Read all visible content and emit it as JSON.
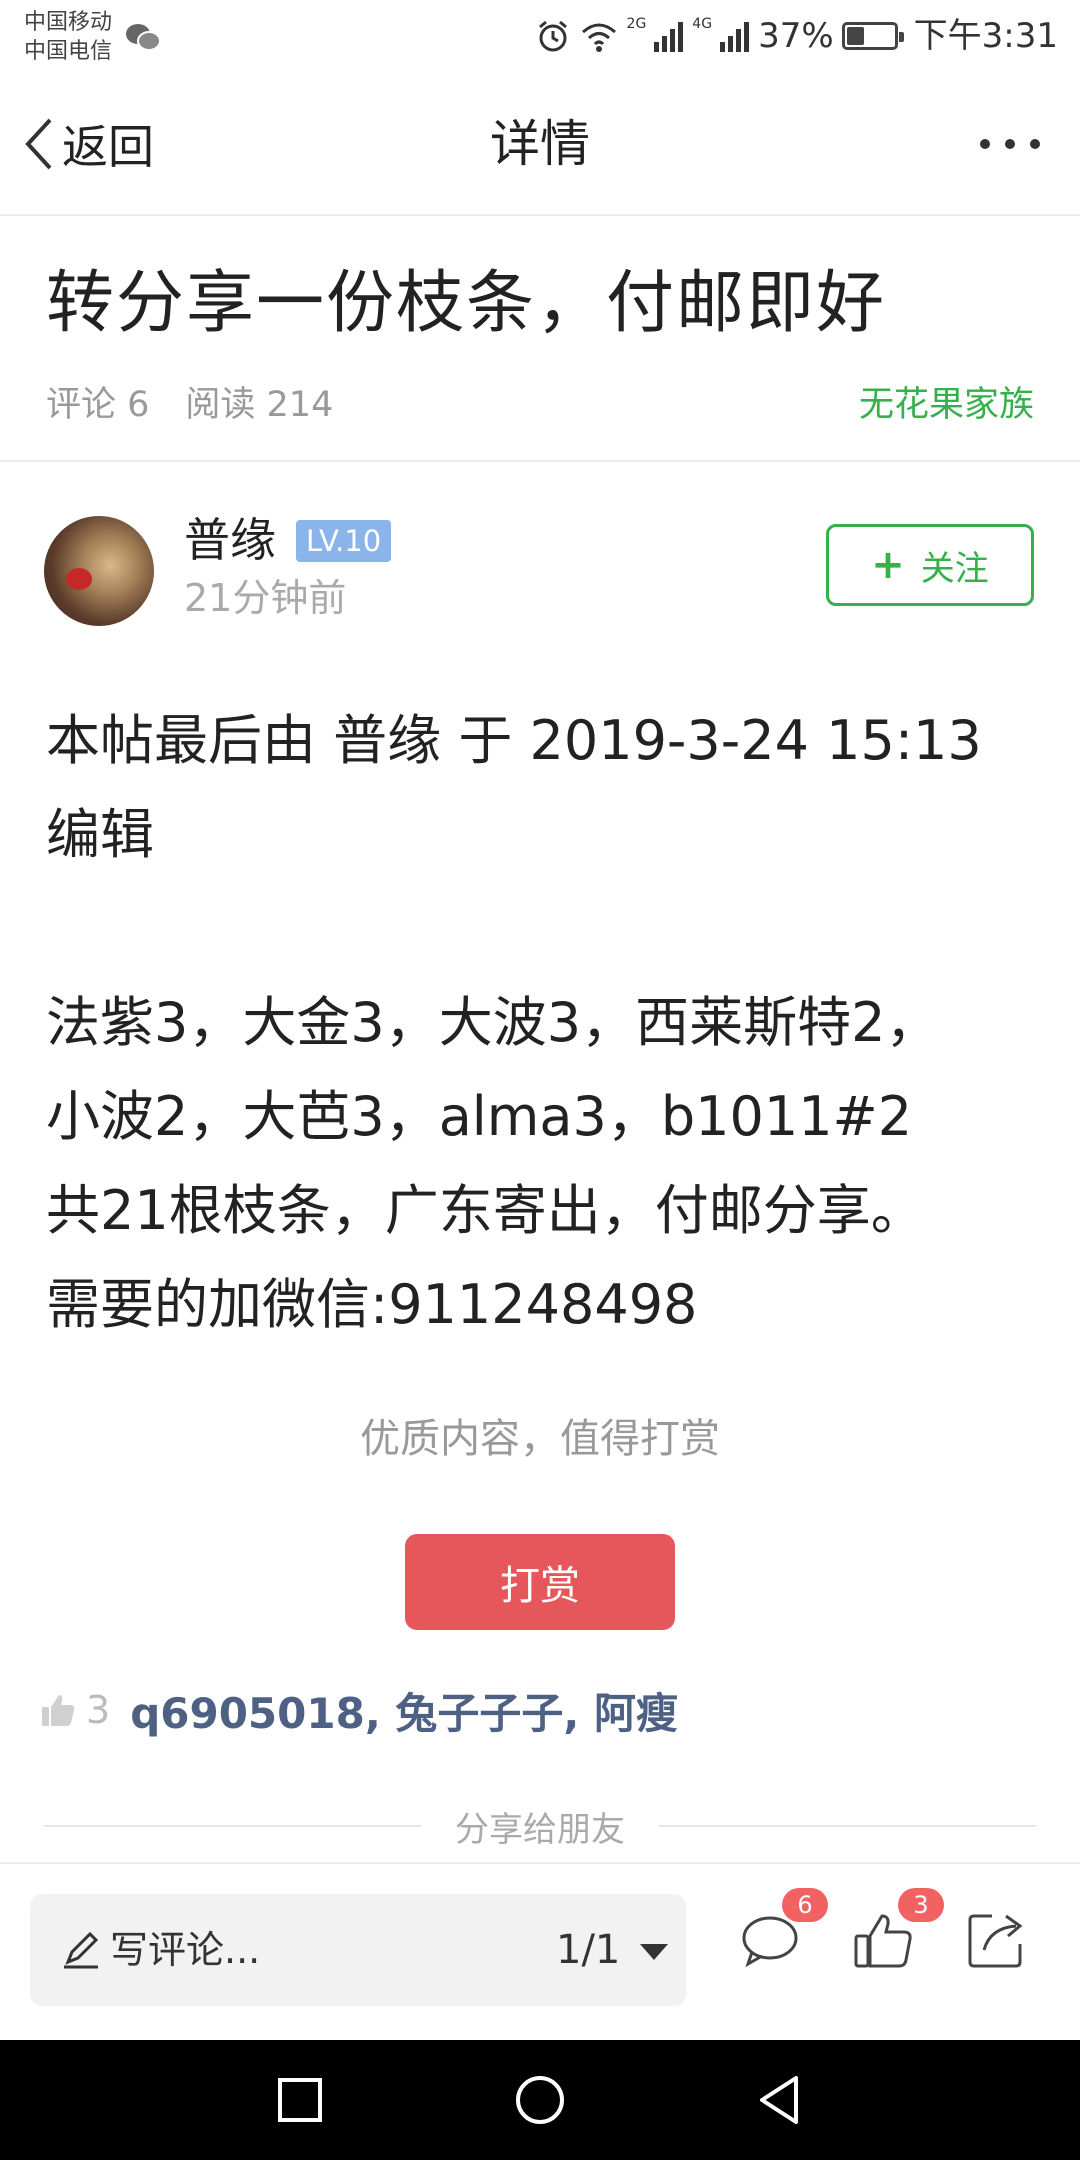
{
  "status_bar": {
    "carrier_1": "中国移动",
    "carrier_2": "中国电信",
    "network_1": "2G",
    "network_2": "4G",
    "battery_text": "37%",
    "battery_level": 0.37,
    "time": "下午3:31"
  },
  "nav": {
    "back_label": "返回",
    "title": "详情",
    "more_icon": "more-dots-icon"
  },
  "post": {
    "title": "转分享一份枝条，付邮即好",
    "comments_label": "评论 6",
    "reads_label": "阅读 214",
    "group": "无花果家族"
  },
  "author": {
    "name": "普缘",
    "level": "LV.10",
    "time_ago": "21分钟前",
    "follow_label": "关注"
  },
  "body": {
    "lines": [
      "本帖最后由 普缘 于 2019-3-24 15:13",
      "编辑",
      "",
      "法紫3，大金3，大波3，西莱斯特2，",
      "小波2，大芭3，alma3，b1011#2",
      "共21根枝条，广东寄出，付邮分享。",
      "需要的加微信:911248498"
    ]
  },
  "reward": {
    "hint": "优质内容，值得打赏",
    "button_label": "打赏"
  },
  "likes": {
    "count": "3",
    "users": "q6905018, 兔子子子, 阿瘦"
  },
  "share": {
    "label": "分享给朋友"
  },
  "bottom_bar": {
    "comment_placeholder": "写评论...",
    "pager": "1/1",
    "comments_badge": "6",
    "likes_badge": "3"
  },
  "colors": {
    "accent_green": "#35b04a",
    "reward_red": "#e6575c",
    "level_blue": "#8bb5ea",
    "liker_blue": "#4e6184",
    "badge_red": "#f26262"
  }
}
